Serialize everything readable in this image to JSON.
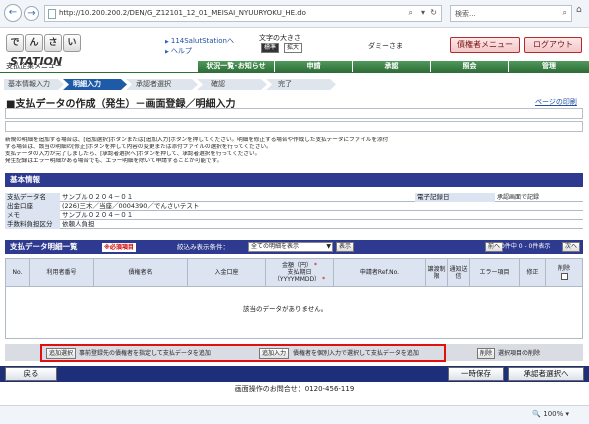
{
  "browser": {
    "url": "http://10.200.200.2/DEN/G_Z12101_12_01_MEISAI_NYUURYOKU_HE.do",
    "search_placeholder": "検索...",
    "zoom": "100%"
  },
  "header": {
    "logo_tiles": [
      "で",
      "ん",
      "さ",
      "い"
    ],
    "logo_text": "STATION",
    "link_1": "114SalutStationへ",
    "link_2": "ヘルプ",
    "font_size_label": "文字の大きさ",
    "font_standard": "標準",
    "font_large": "拡大",
    "user": "ダミーさま",
    "creditor_menu_btn": "債権者メニュー",
    "logout_btn": "ログアウト"
  },
  "menu_label": "支払企業メニュー",
  "nav_tabs": [
    "状況一覧･お知らせ",
    "申請",
    "承認",
    "照会",
    "管理"
  ],
  "steps": [
    "基本情報入力",
    "明細入力",
    "承認者選択",
    "確認",
    "完了"
  ],
  "active_step": 1,
  "page_title": "■支払データの作成（発生）－画面登録／明細入力",
  "print_link": "ページの印刷",
  "instructions": [
    "新規の明細を追加する場合は、[追加選択]ボタンまたは[追加入力]ボタンを押してください。明細を修正する場合や作成した支払データにファイルを添付",
    "する場合は、該当の明細の[修正]ボタンを押して内容の変更または添付ファイルの選択を行ってください。",
    "支払データの入力が完了しましたら、[承認者選択へ]ボタンを押して、承認者選択を行ってください。",
    "発生記録はエラー明細がある場合でも、エラー明細を除いて申請することが可能です。"
  ],
  "basic_info": {
    "heading": "基本情報",
    "rows": [
      {
        "key": "支払データ名",
        "value": "サンプル０２０４－０１",
        "key2": "電子記録日",
        "value2": "承認画面で記録"
      },
      {
        "key": "出金口座",
        "value": "(226)三木／当座／0004390／でんさいテスト",
        "key2": "",
        "value2": ""
      },
      {
        "key": "メモ",
        "value": "サンプル０２０４－０１",
        "key2": "",
        "value2": ""
      },
      {
        "key": "手数料負担区分",
        "value": "依頼人負担",
        "key2": "",
        "value2": ""
      }
    ]
  },
  "detail_list": {
    "heading": "支払データ明細一覧",
    "badge": "※必須項目",
    "filter_label": "絞込み表示条件：",
    "filter_value": "全ての明細を表示",
    "display_btn": "表示",
    "prev_btn": "前へ",
    "next_btn": "次へ",
    "count_text": "0件中 0 - 0件表示",
    "columns": [
      "No.",
      "利用者番号",
      "債権者名",
      "入金口座",
      "金額（円）",
      "支払期日（YYYYMMDD）",
      "申請者Ref.No.",
      "譲渡制限",
      "通知送信",
      "エラー項目",
      "修正",
      "削除"
    ],
    "empty_message": "該当のデータがありません。"
  },
  "actions": {
    "add_select_btn": "追加選択",
    "add_select_desc": "事前登録先の債権者を指定して支払データを追加",
    "add_input_btn": "追加入力",
    "add_input_desc": "債権者を個別入力で選択して支払データを追加",
    "delete_btn": "削除",
    "delete_desc": "選択項目の削除"
  },
  "bottom": {
    "back_btn": "戻る",
    "save_btn": "一時保存",
    "next_btn": "承認者選択へ"
  },
  "footer_text": "画面操作のお問合せ：0120-456-119",
  "colors": {
    "nav_green": "#3f8a4b",
    "section_navy": "#2e3a8f",
    "step_active": "#1f5aa8",
    "highlight_red": "#e01010"
  }
}
